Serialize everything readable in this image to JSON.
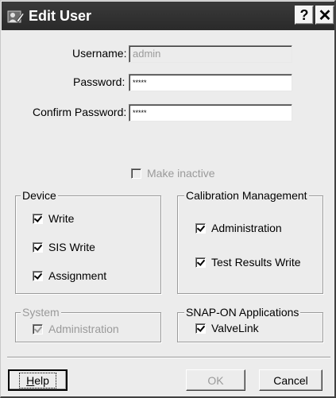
{
  "window": {
    "title": "Edit User",
    "help_button": "?",
    "close_button": "✕"
  },
  "form": {
    "username_label": "Username:",
    "username_value": "admin",
    "password_label": "Password:",
    "password_value": "*****",
    "confirm_label": "Confirm Password:",
    "confirm_value": "*****",
    "make_inactive_label": "Make inactive",
    "make_inactive_checked": false
  },
  "device": {
    "legend": "Device",
    "items": [
      {
        "label": "Write",
        "checked": true
      },
      {
        "label": "SIS Write",
        "checked": true
      },
      {
        "label": "Assignment",
        "checked": true
      }
    ]
  },
  "calibration": {
    "legend": "Calibration Management",
    "items": [
      {
        "label": "Administration",
        "checked": true
      },
      {
        "label": "Test Results Write",
        "checked": true
      }
    ]
  },
  "system": {
    "legend": "System",
    "items": [
      {
        "label": "Administration",
        "checked": true
      }
    ]
  },
  "snapon": {
    "legend": "SNAP-ON Applications",
    "items": [
      {
        "label": "ValveLink",
        "checked": true
      }
    ]
  },
  "buttons": {
    "help_prefix": "H",
    "help_rest": "elp",
    "ok": "OK",
    "cancel": "Cancel"
  },
  "colors": {
    "titlebar": "#2f2f2f",
    "dialog_bg": "#ececec",
    "disabled_text": "#9a9a9a"
  }
}
